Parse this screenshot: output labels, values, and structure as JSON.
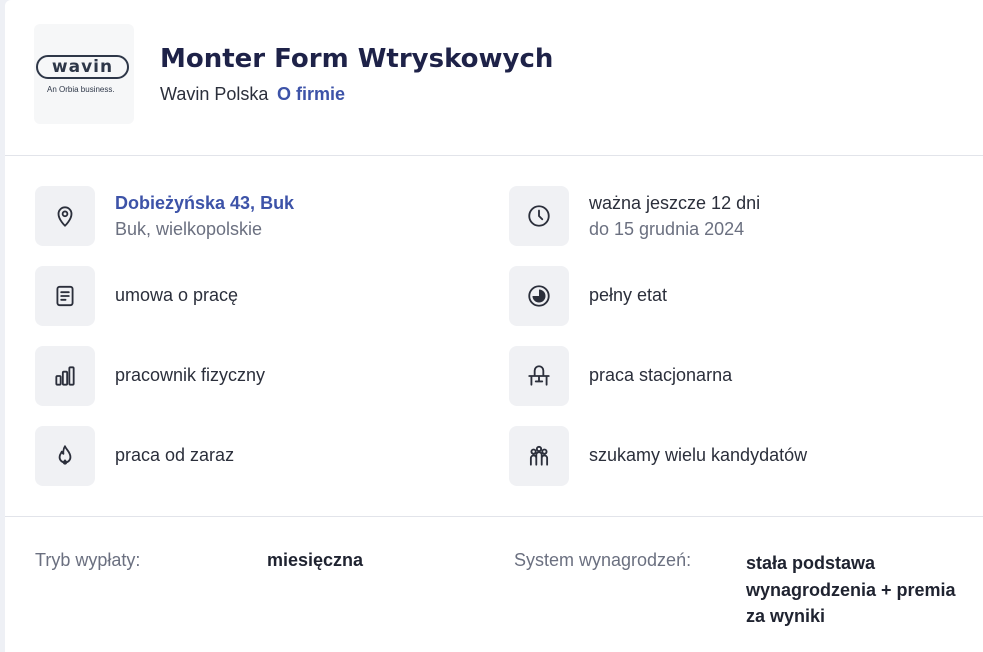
{
  "company": {
    "logo_text": "wavin",
    "logo_subtitle": "An Orbia business.",
    "name": "Wavin Polska",
    "about_link": "O firmie"
  },
  "job": {
    "title": "Monter Form Wtryskowych"
  },
  "details": {
    "address": {
      "line1": "Dobieżyńska 43, Buk",
      "line2": "Buk, wielkopolskie",
      "icon": "location-pin-icon"
    },
    "validity": {
      "line1": "ważna jeszcze 12 dni",
      "line2": "do 15 grudnia 2024",
      "icon": "clock-icon"
    },
    "contract": {
      "text": "umowa o pracę",
      "icon": "document-icon"
    },
    "worktime": {
      "text": "pełny etat",
      "icon": "pie-icon"
    },
    "level": {
      "text": "pracownik fizyczny",
      "icon": "bar-chart-icon"
    },
    "mode": {
      "text": "praca stacjonarna",
      "icon": "desk-icon"
    },
    "start": {
      "text": "praca od zaraz",
      "icon": "flame-icon"
    },
    "recruitment": {
      "text": "szukamy wielu kandydatów",
      "icon": "people-icon"
    }
  },
  "payment": {
    "mode_label": "Tryb wypłaty:",
    "mode_value": "miesięczna",
    "system_label": "System wynagrodzeń:",
    "system_value": "stała podstawa wynagrodzenia + premia za wyniki"
  },
  "colors": {
    "title": "#1e2248",
    "link": "#3d53a8",
    "muted": "#6b7080",
    "icon_bg": "#f0f1f4"
  }
}
